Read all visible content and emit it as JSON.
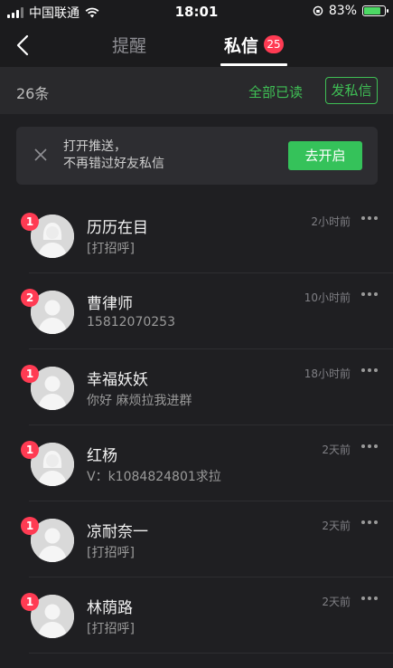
{
  "status_bar": {
    "carrier": "中国联通",
    "time": "18:01",
    "battery": "83%",
    "battery_level": 0.83
  },
  "nav": {
    "tabs": [
      {
        "label": "提醒",
        "active": false
      },
      {
        "label": "私信",
        "active": true,
        "badge": "25"
      }
    ]
  },
  "subheader": {
    "count": "26条",
    "mark_all_read": "全部已读",
    "send_message": "发私信"
  },
  "push_banner": {
    "line1": "打开推送，",
    "line2": "不再错过好友私信",
    "button": "去开启"
  },
  "messages": [
    {
      "badge": "1",
      "name": "历历在目",
      "preview": "[打招呼]",
      "time": "2小时前",
      "avatar": "female"
    },
    {
      "badge": "2",
      "name": "曹律师",
      "preview": "15812070253",
      "time": "10小时前",
      "avatar": "male"
    },
    {
      "badge": "1",
      "name": "幸福妖妖",
      "preview": "你好  麻烦拉我进群",
      "time": "18小时前",
      "avatar": "male"
    },
    {
      "badge": "1",
      "name": "红杨",
      "preview": "V：k1084824801求拉",
      "time": "2天前",
      "avatar": "female"
    },
    {
      "badge": "1",
      "name": "凉耐奈一",
      "preview": "[打招呼]",
      "time": "2天前",
      "avatar": "male"
    },
    {
      "badge": "1",
      "name": "林荫路",
      "preview": "[打招呼]",
      "time": "2天前",
      "avatar": "male"
    }
  ],
  "colors": {
    "accent_green": "#3fbf55",
    "badge_red": "#ff3b53",
    "background": "#1f1f22"
  }
}
